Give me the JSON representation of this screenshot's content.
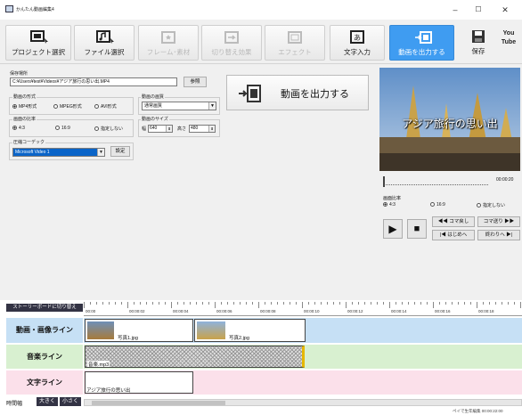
{
  "window": {
    "title": "かんたん動画編集4",
    "controls": {
      "minimize": "–",
      "maximize": "☐",
      "close": "✕"
    }
  },
  "toolbar": {
    "project_select": "プロジェクト選択",
    "file_select": "ファイル選択",
    "frame_material": "フレーム･素材",
    "transition": "切り替え効果",
    "effect": "エフェクト",
    "text_input": "文字入力",
    "export_video": "動画を出力する",
    "save": "保存",
    "youtube": "You Tube",
    "icons": {
      "project": "project-window-icon",
      "file": "film-note-icon",
      "frame": "frame-icon",
      "transition": "transition-icon",
      "effect": "effect-icon",
      "text": "text-input-icon",
      "export": "export-video-icon",
      "save": "floppy-disk-icon",
      "youtube": "youtube-icon"
    },
    "accent_color": "#3f9cf1"
  },
  "settings": {
    "save_location_label": "保存場所",
    "save_path": "C:¥Users¥test¥Videos¥アジア旅行の思い出.MP4",
    "browse_button": "参照",
    "format_label": "動画の形式",
    "formats": [
      "MP4形式",
      "MPEG形式",
      "AVI形式"
    ],
    "format_selected": "MP4形式",
    "quality_label": "動画の画質",
    "quality_value": "通常画質",
    "aspect_label": "画面の比率",
    "aspects": [
      "4:3",
      "16:9",
      "指定しない"
    ],
    "aspect_selected": "4:3",
    "size_label": "動画のサイズ",
    "width_label": "幅",
    "width_value": "640",
    "height_label": "高さ",
    "height_value": "480",
    "codec_label": "圧縮コーデック",
    "codec_value": "Microsoft Video 1",
    "codec_settings_button": "設定",
    "export_button": "動画を出力する"
  },
  "preview": {
    "overlay_title": "アジア旅行の思い出",
    "time": "00:00:20",
    "ratio_label": "画面比率",
    "ratios": [
      "4:3",
      "16:9",
      "指定しない"
    ],
    "ratio_selected": "4:3",
    "prev_frame": "◀◀ コマ戻し",
    "next_frame": "コマ送り ▶▶",
    "to_start": "|◀ はじめへ",
    "to_end": "終わりへ ▶|",
    "play": "▶",
    "stop": "■"
  },
  "timeline": {
    "storyboard_button": "ストーリーボードに切り替え",
    "ruler": [
      "00:00",
      "00:00:02",
      "00:00:04",
      "00:00:06",
      "00:00:08",
      "00:00:10",
      "00:00:12",
      "00:00:14",
      "00:00:16",
      "00:00:18",
      "00:00:2"
    ],
    "video_track_label": "動画・画像ライン",
    "music_track_label": "音楽ライン",
    "text_track_label": "文字ライン",
    "clips": {
      "photo1": "写真1.jpg",
      "photo2": "写真2.jpg",
      "music": "音楽.mp3",
      "text": "アジア旅行の思い出"
    },
    "zoom_label": "時間幅",
    "zoom_in": "大きく",
    "zoom_out": "小さく",
    "status_text": "ペイで生年編集 00:00:22:00",
    "track_colors": {
      "video": "#c6e0f5",
      "music": "#d8f0d0",
      "text": "#fbe0ea"
    }
  }
}
